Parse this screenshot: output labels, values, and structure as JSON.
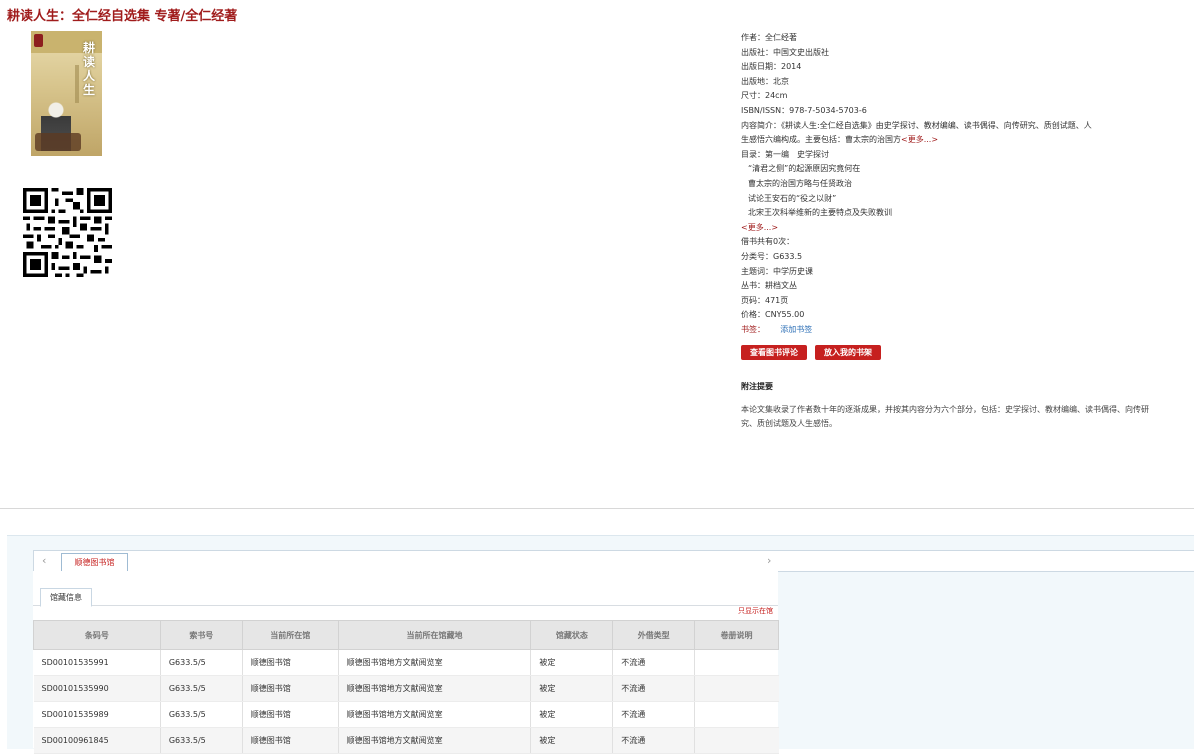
{
  "page": {
    "title": "耕读人生：全仁经自选集 专著/全仁经著"
  },
  "cover": {
    "title_text": "耕读人生"
  },
  "info": {
    "rows": [
      "作者：全仁经著",
      "出版社：中国文史出版社",
      "出版日期：2014",
      "出版地：北京",
      "尺寸：24cm",
      "ISBN/ISSN：978-7-5034-5703-6",
      "内容简介：《耕读人生:全仁经自选集》由史学探讨、教材编编、读书偶得、向传研究、质创试题、人"
    ],
    "summary_cont": "生感悟六编构成。主要包括：曹太宗的治国方",
    "summary_more": "<更多...>",
    "toc_label": "目录：第一编　史学探讨",
    "toc_items": [
      "“清君之侧”的起源原因究竟何在",
      "曹太宗的治国方略与任贤政治",
      "试论王安石的“役之以财”",
      "北宋王次科举维新的主要特点及失败教训"
    ],
    "toc_more": "<更多...>",
    "rows2": [
      "借书共有0次：",
      "分类号：G633.5",
      "主题词：中学历史课",
      "丛书：耕档文丛",
      "页码：471页",
      "价格：CNY55.00"
    ],
    "bookmark_label": "书签：",
    "bookmark_link": "添加书签"
  },
  "buttons": {
    "review": "查看图书评论",
    "shelf": "放入我的书架"
  },
  "notes": {
    "heading": "附注提要",
    "text": "本论文集收录了作者数十年的逐渐成果，并按其内容分为六个部分，包括：史学探讨、教材编编、读书偶得、向传研究、质创试题及人生感悟。"
  },
  "holdings": {
    "tab_prev": "‹",
    "tab_next": "›",
    "library_tab": "顺德图书馆",
    "sub_tab": "馆藏信息",
    "only_here": "只显示在馆",
    "columns": [
      "条码号",
      "索书号",
      "当前所在馆",
      "当前所在馆藏地",
      "馆藏状态",
      "外借类型",
      "卷册说明"
    ],
    "rows": [
      [
        "SD00101535991",
        "G633.5/5",
        "顺德图书馆",
        "顺德图书馆地方文献阅览室",
        "被定",
        "不流通",
        ""
      ],
      [
        "SD00101535990",
        "G633.5/5",
        "顺德图书馆",
        "顺德图书馆地方文献阅览室",
        "被定",
        "不流通",
        ""
      ],
      [
        "SD00101535989",
        "G633.5/5",
        "顺德图书馆",
        "顺德图书馆地方文献阅览室",
        "被定",
        "不流通",
        ""
      ],
      [
        "SD00100961845",
        "G633.5/5",
        "顺德图书馆",
        "顺德图书馆地方文献阅览室",
        "被定",
        "不流通",
        ""
      ]
    ]
  },
  "colors": {
    "accent": "#a01c1c",
    "button": "#c6201f",
    "link": "#2a6db5"
  }
}
